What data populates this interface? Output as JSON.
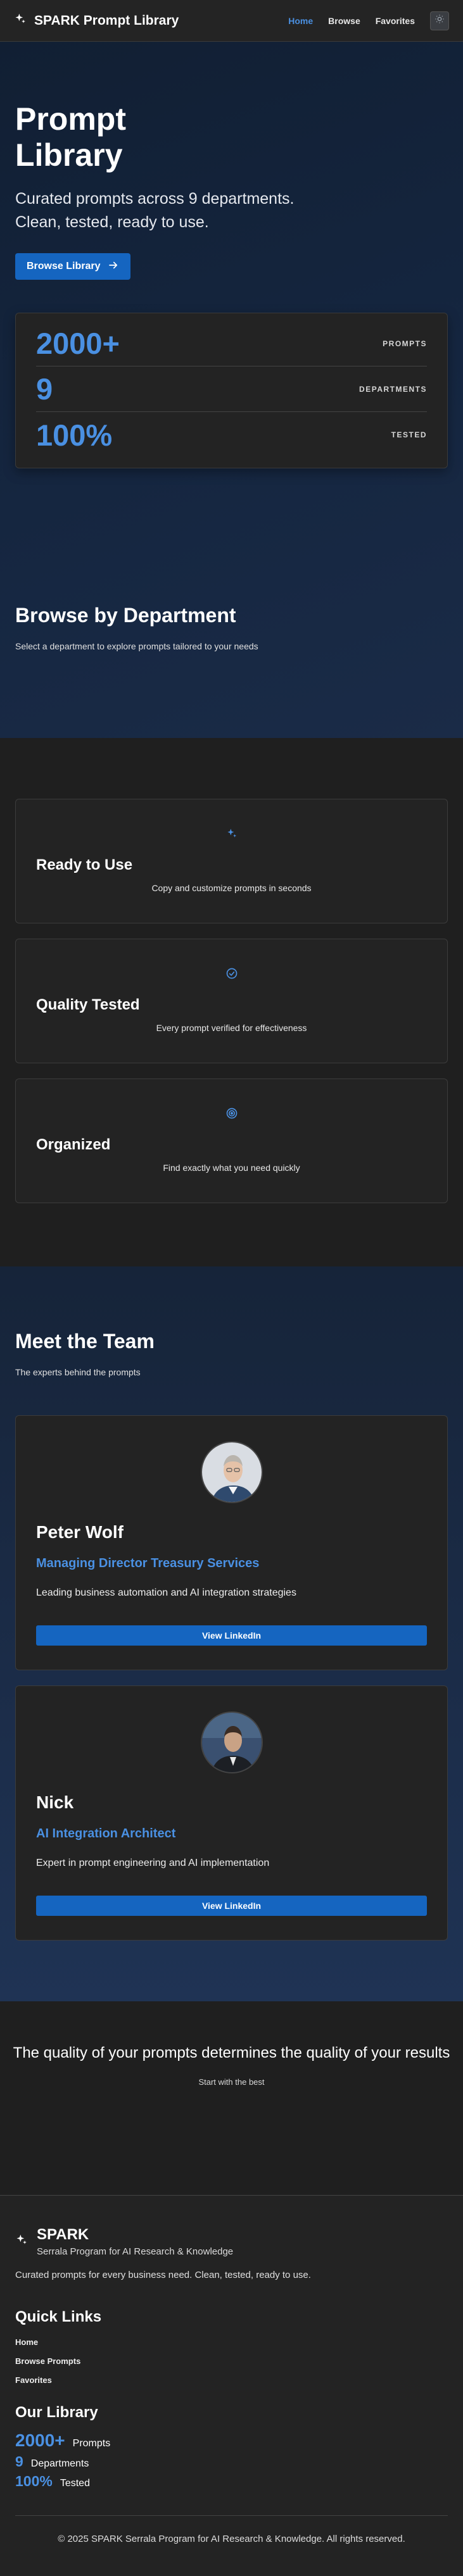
{
  "nav": {
    "brand": "SPARK Prompt Library",
    "brand_icon": "sparkles-icon",
    "links": [
      "Home",
      "Browse",
      "Favorites"
    ],
    "active": "Home",
    "theme_icon": "sun-icon"
  },
  "hero": {
    "title_line1": "Prompt",
    "title_line2": "Library",
    "subtitle_line1": "Curated prompts across 9 departments.",
    "subtitle_line2": "Clean, tested, ready to use.",
    "cta": "Browse Library",
    "stats": [
      {
        "value": "2000+",
        "label": "PROMPTS"
      },
      {
        "value": "9",
        "label": "DEPARTMENTS"
      },
      {
        "value": "100%",
        "label": "TESTED"
      }
    ]
  },
  "departments": {
    "title": "Browse by Department",
    "subtitle": "Select a department to explore prompts tailored to your needs"
  },
  "features": [
    {
      "icon": "sparkles-icon",
      "title": "Ready to Use",
      "text": "Copy and customize prompts in seconds"
    },
    {
      "icon": "check-circle-icon",
      "title": "Quality Tested",
      "text": "Every prompt verified for effectiveness"
    },
    {
      "icon": "target-icon",
      "title": "Organized",
      "text": "Find exactly what you need quickly"
    }
  ],
  "team": {
    "title": "Meet the Team",
    "subtitle": "The experts behind the prompts",
    "members": [
      {
        "name": "Peter Wolf",
        "role": "Managing Director Treasury Services",
        "desc": "Leading business automation and AI integration strategies",
        "button": "View LinkedIn"
      },
      {
        "name": "Nick",
        "role": "AI Integration Architect",
        "desc": "Expert in prompt engineering and AI implementation",
        "button": "View LinkedIn"
      }
    ]
  },
  "quote": {
    "text": "The quality of your prompts determines the quality of your results",
    "sub": "Start with the best"
  },
  "footer": {
    "brand": "SPARK",
    "tagline": "Serrala Program for AI Research & Knowledge",
    "desc": "Curated prompts for every business need. Clean, tested, ready to use.",
    "quick_links_title": "Quick Links",
    "quick_links": [
      "Home",
      "Browse Prompts",
      "Favorites"
    ],
    "library_title": "Our Library",
    "library": [
      {
        "value": "2000+",
        "label": "Prompts"
      },
      {
        "value": "9",
        "label": "Departments"
      },
      {
        "value": "100%",
        "label": "Tested"
      }
    ],
    "copyright": "© 2025 SPARK Serrala Program for AI Research & Knowledge. All rights reserved."
  },
  "colors": {
    "accent": "#4a90e2",
    "button": "#1565c0",
    "background": "#1f1f1f"
  }
}
